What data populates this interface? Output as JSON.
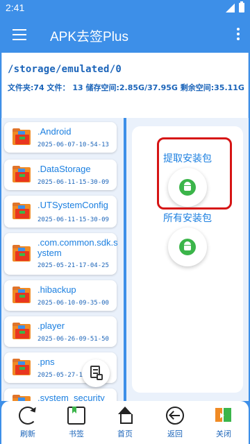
{
  "status_bar": {
    "time": "2:41"
  },
  "app_bar": {
    "title": "APK去签Plus"
  },
  "path_panel": {
    "path": "/storage/emulated/0",
    "info": "文件夹:74   文件： 13   储存空间:2.85G/37.95G  剩余空间:35.11G"
  },
  "files": [
    {
      "name": ".Android",
      "date": "2025-06-07-10-54-13"
    },
    {
      "name": ".DataStorage",
      "date": "2025-06-11-15-30-09"
    },
    {
      "name": ".UTSystemConfig",
      "date": "2025-06-11-15-30-09"
    },
    {
      "name": ".com.common.sdk.system",
      "date": "2025-05-21-17-04-25"
    },
    {
      "name": ".hibackup",
      "date": "2025-06-10-09-35-00"
    },
    {
      "name": ".player",
      "date": "2025-06-26-09-51-50"
    },
    {
      "name": ".pns",
      "date": "2025-05-27-1"
    },
    {
      "name": ".system_security",
      "date": ""
    }
  ],
  "actions": {
    "extract_label": "提取安装包",
    "all_label": "所有安装包"
  },
  "bottom_nav": [
    {
      "label": "刷新",
      "icon": "refresh-icon"
    },
    {
      "label": "书签",
      "icon": "bookmark-icon"
    },
    {
      "label": "首页",
      "icon": "home-icon"
    },
    {
      "label": "返回",
      "icon": "back-icon"
    },
    {
      "label": "关闭",
      "icon": "exit-icon"
    }
  ],
  "colors": {
    "primary": "#3d8fe8",
    "accent_text": "#1b7fe0",
    "highlight": "#d61414",
    "android_green": "#3bb54a"
  }
}
